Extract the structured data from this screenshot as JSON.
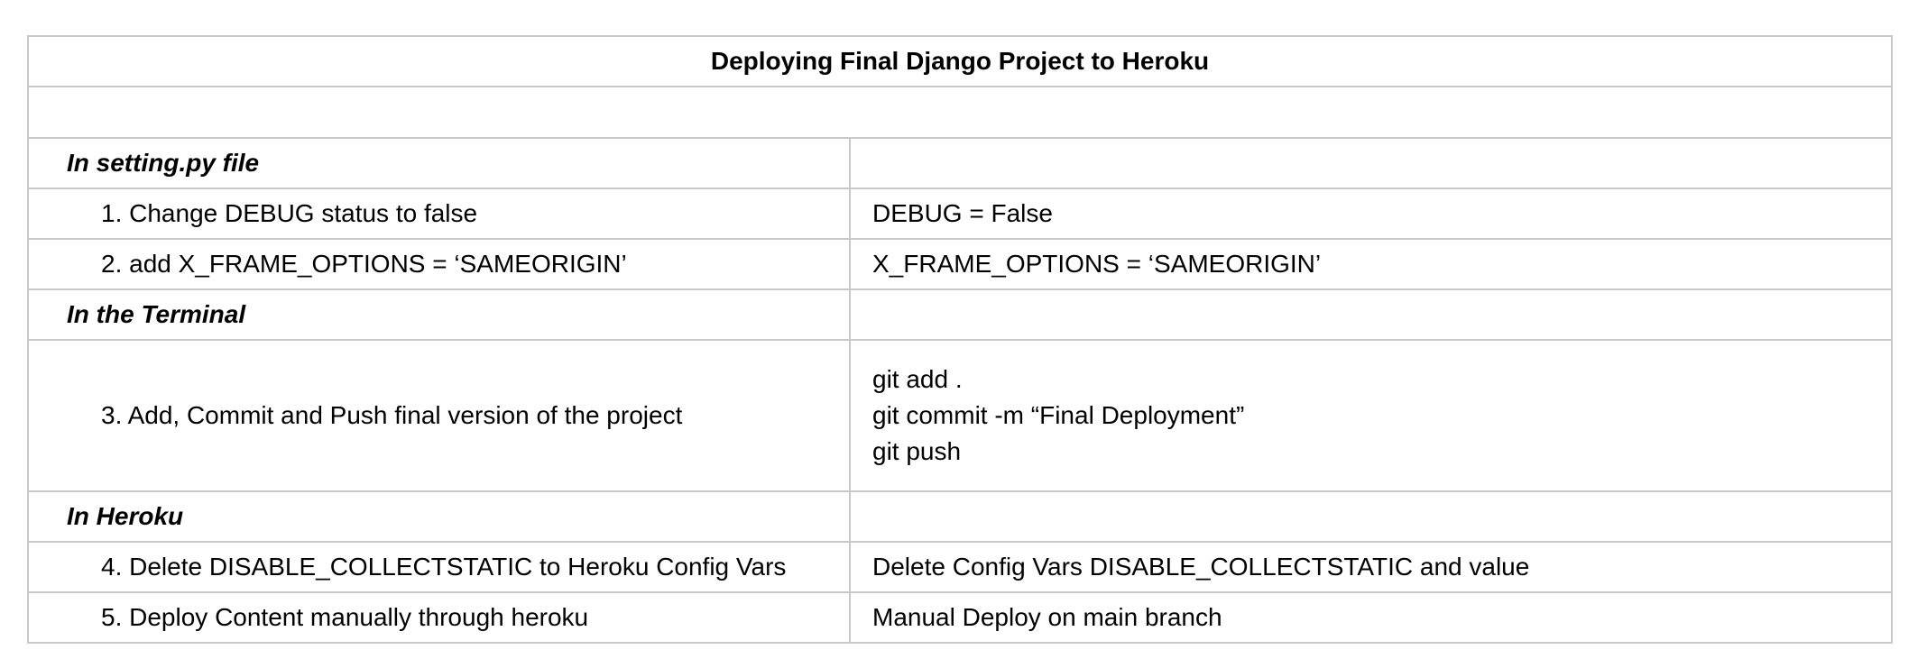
{
  "document": {
    "title": "Deploying Final Django Project to Heroku",
    "sections": [
      {
        "heading": "In setting.py file",
        "steps": [
          {
            "text": "1. Change DEBUG status to false",
            "value_lines": [
              "DEBUG = False"
            ]
          },
          {
            "text": "2. add X_FRAME_OPTIONS = ‘SAMEORIGIN’",
            "value_lines": [
              "X_FRAME_OPTIONS = ‘SAMEORIGIN’"
            ]
          }
        ]
      },
      {
        "heading": "In the Terminal",
        "steps": [
          {
            "text": "3. Add, Commit and Push final version of the project",
            "value_lines": [
              "git add .",
              "git commit -m “Final Deployment”",
              "git push"
            ]
          }
        ]
      },
      {
        "heading": "In Heroku",
        "steps": [
          {
            "text": "4. Delete DISABLE_COLLECTSTATIC to Heroku Config Vars",
            "value_lines": [
              "Delete Config Vars DISABLE_COLLECTSTATIC and value"
            ]
          },
          {
            "text": "5. Deploy Content manually through heroku",
            "value_lines": [
              "Manual Deploy on main branch"
            ]
          }
        ]
      }
    ]
  },
  "colors": {
    "border": "#c8c8c8",
    "text": "#000000",
    "background": "#ffffff"
  }
}
